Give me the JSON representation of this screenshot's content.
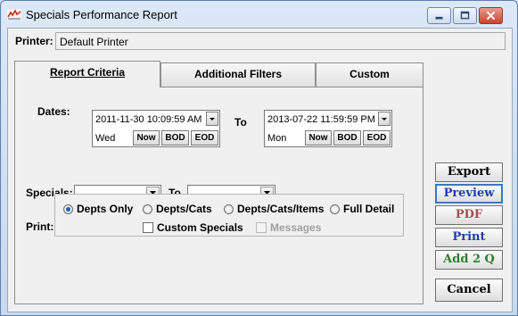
{
  "window": {
    "title": "Specials Performance Report"
  },
  "printer": {
    "label": "Printer:",
    "value": "Default Printer"
  },
  "tabs": [
    {
      "label": "Report Criteria",
      "active": true
    },
    {
      "label": "Additional Filters",
      "active": false
    },
    {
      "label": "Custom",
      "active": false
    }
  ],
  "criteria": {
    "dates_label": "Dates:",
    "to_label": "To",
    "start": {
      "datetime": "2011-11-30 10:09:59 AM",
      "day": "Wed"
    },
    "end": {
      "datetime": "2013-07-22 11:59:59 PM",
      "day": "Mon"
    },
    "now_label": "Now",
    "bod_label": "BOD",
    "eod_label": "EOD",
    "specials_label": "Specials:",
    "specials_to_label": "To",
    "specials_from_value": "",
    "specials_to_value": ""
  },
  "print_options": {
    "label": "Print:",
    "radios": [
      {
        "label": "Depts Only",
        "selected": true
      },
      {
        "label": "Depts/Cats",
        "selected": false
      },
      {
        "label": "Depts/Cats/Items",
        "selected": false
      },
      {
        "label": "Full Detail",
        "selected": false
      }
    ],
    "checkboxes": [
      {
        "label": "Custom Specials",
        "checked": false,
        "enabled": true
      },
      {
        "label": "Messages",
        "checked": false,
        "enabled": false
      }
    ]
  },
  "actions": {
    "export": {
      "label": "Export",
      "color": "#000000"
    },
    "preview": {
      "label": "Preview",
      "color": "#1f3fa8"
    },
    "pdf": {
      "label": "PDF",
      "color": "#a05050"
    },
    "print": {
      "label": "Print",
      "color": "#1f3fa8"
    },
    "add2q": {
      "label": "Add 2 Q",
      "color": "#2e7d2e"
    },
    "cancel": {
      "label": "Cancel",
      "color": "#000000"
    }
  }
}
